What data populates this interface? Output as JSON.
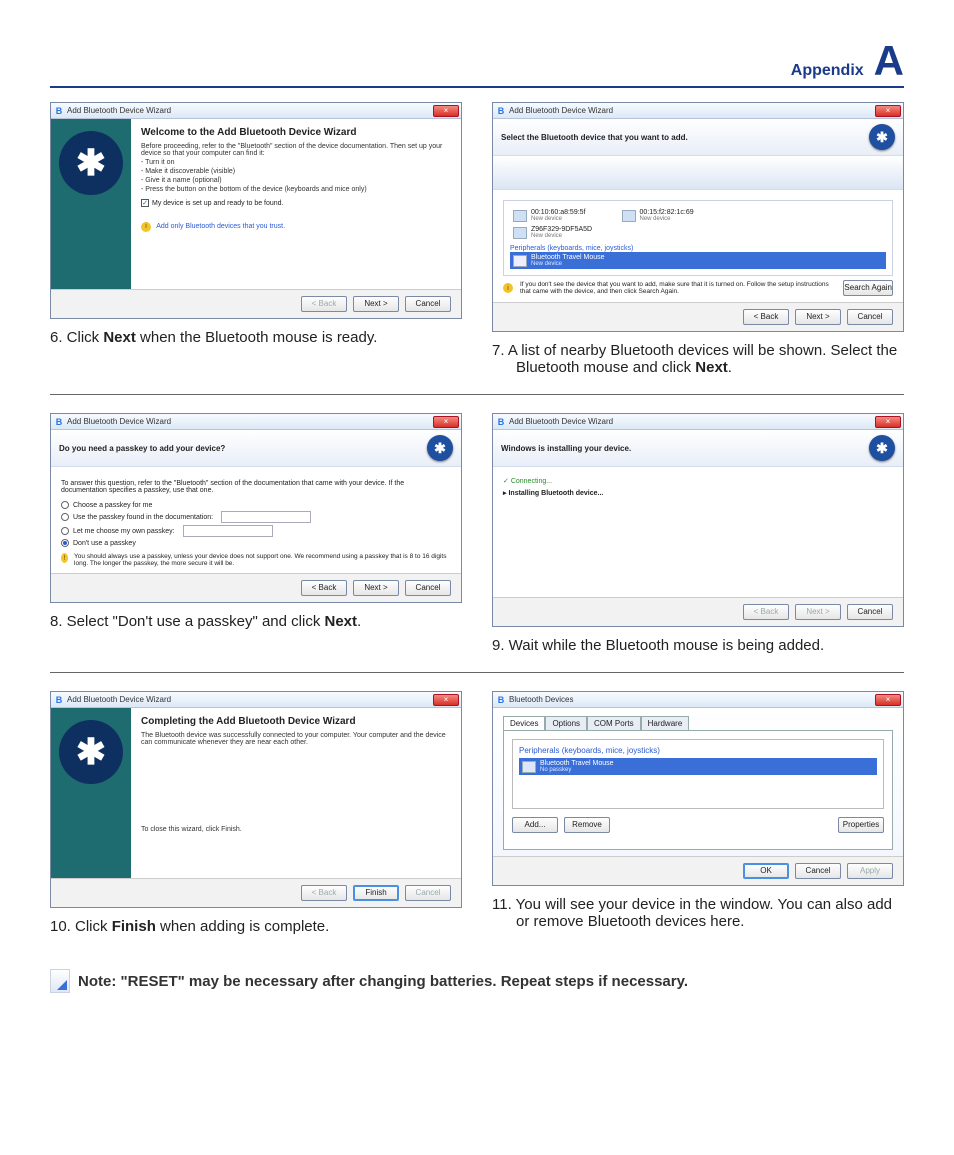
{
  "header": {
    "title": "Appendix",
    "letter": "A"
  },
  "wiz_title": "Add Bluetooth Device Wizard",
  "bt_devices_title": "Bluetooth Devices",
  "buttons": {
    "back": "< Back",
    "next": "Next >",
    "cancel": "Cancel",
    "finish": "Finish",
    "search": "Search Again",
    "add": "Add...",
    "remove": "Remove",
    "properties": "Properties",
    "ok": "OK",
    "apply": "Apply"
  },
  "s6": {
    "heading": "Welcome to the Add Bluetooth Device Wizard",
    "p1": "Before proceeding, refer to the \"Bluetooth\" section of the device documentation. Then set up your device so that your computer can find it:",
    "li1": "- Turn it on",
    "li2": "- Make it discoverable (visible)",
    "li3": "- Give it a name (optional)",
    "li4": "- Press the button on the bottom of the device (keyboards and mice only)",
    "chk": "My device is set up and ready to be found.",
    "link": "Add only Bluetooth devices that you trust."
  },
  "cap6_a": "6.   Click ",
  "cap6_b": "Next",
  "cap6_c": " when the Bluetooth mouse is ready.",
  "s7": {
    "heading": "Select the Bluetooth device that you want to add.",
    "d1": "00:10:60:a8:59:5f",
    "d1s": "New device",
    "d2": "00:15:f2:82:1c:69",
    "d2s": "New device",
    "d3": "Z96F329-9DF5A5D",
    "d3s": "New device",
    "grp": "Peripherals (keyboards, mice, joysticks)",
    "d4": "Bluetooth Travel Mouse",
    "d4s": "New device",
    "tip": "If you don't see the device that you want to add, make sure that it is turned on. Follow the setup instructions that came with the device, and then click Search Again."
  },
  "cap7_a": "7.   A list of nearby Bluetooth devices will be shown. Select the Bluetooth mouse and click ",
  "cap7_b": "Next",
  "cap7_c": ".",
  "s8": {
    "heading": "Do you need a passkey to add your device?",
    "intro": "To answer this question, refer to the \"Bluetooth\" section of the documentation that came with your device. If the documentation specifies a passkey, use that one.",
    "r1": "Choose a passkey for me",
    "r2": "Use the passkey found in the documentation:",
    "r3": "Let me choose my own passkey:",
    "r4": "Don't use a passkey",
    "warn": "You should always use a passkey, unless your device does not support one. We recommend using a passkey that is 8 to 16 digits long. The longer the passkey, the more secure it will be."
  },
  "cap8_a": "8.   Select \"Don't use a passkey\" and click ",
  "cap8_b": "Next",
  "cap8_c": ".",
  "s9": {
    "heading": "Windows is installing your device.",
    "l1": "Connecting...",
    "l2": "Installing Bluetooth device..."
  },
  "cap9": "9.   Wait while the Bluetooth mouse is being added.",
  "s10": {
    "heading": "Completing the Add Bluetooth Device Wizard",
    "p1": "The Bluetooth device was successfully connected to your computer. Your computer and the device can communicate whenever they are near each other.",
    "p2": "To close this wizard, click Finish."
  },
  "cap10_a": "10. Click ",
  "cap10_b": "Finish",
  "cap10_c": " when adding is complete.",
  "s11": {
    "tabs": [
      "Devices",
      "Options",
      "COM Ports",
      "Hardware"
    ],
    "grp": "Peripherals (keyboards, mice, joysticks)",
    "dev": "Bluetooth Travel Mouse",
    "sub": "No passkey"
  },
  "cap11": "11. You will see your device in the window. You can also add or remove Bluetooth devices here.",
  "note": "Note: \"RESET\" may be necessary after changing batteries. Repeat steps if necessary."
}
